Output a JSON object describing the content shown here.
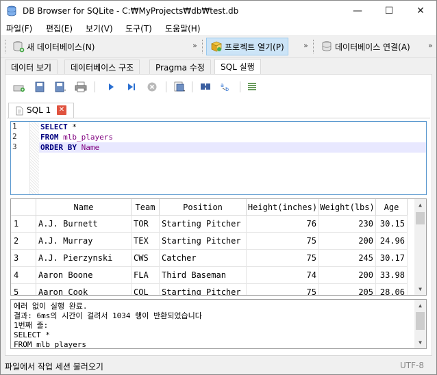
{
  "window": {
    "title": "DB Browser for SQLite - C:₩MyProjects₩db₩test.db",
    "controls": {
      "minimize": "—",
      "maximize": "☐",
      "close": "✕"
    }
  },
  "menu": [
    "파일(F)",
    "편집(E)",
    "보기(V)",
    "도구(T)",
    "도움말(H)"
  ],
  "main_toolbar": {
    "new_db": "새 데이터베이스(N)",
    "open_project": "프로젝트 열기(P)",
    "attach_db": "데이터베이스 연결(A)",
    "overflow": "»"
  },
  "tabs": [
    {
      "label": "데이터 보기",
      "active": false
    },
    {
      "label": "데이터베이스 구조",
      "active": false
    },
    {
      "label": "Pragma 수정",
      "active": false
    },
    {
      "label": "SQL 실행",
      "active": true
    }
  ],
  "sql_tab": {
    "label": "SQL 1",
    "close": "✕"
  },
  "editor": {
    "line_numbers": [
      "1",
      "2",
      "3"
    ],
    "lines": [
      [
        {
          "t": "SELECT ",
          "c": "kw"
        },
        {
          "t": "*",
          "c": ""
        }
      ],
      [
        {
          "t": "FROM ",
          "c": "kw"
        },
        {
          "t": "mlb_players",
          "c": "id"
        }
      ],
      [
        {
          "t": "ORDER BY ",
          "c": "kw"
        },
        {
          "t": "Name",
          "c": "id"
        }
      ]
    ],
    "current_line": 3
  },
  "results": {
    "columns": [
      "Name",
      "Team",
      "Position",
      "Height(inches)",
      "Weight(lbs)",
      "Age"
    ],
    "numeric_columns": [
      3,
      4,
      5
    ],
    "rows": [
      {
        "n": "1",
        "cells": [
          "A.J. Burnett",
          "TOR",
          "Starting Pitcher",
          "76",
          "230",
          "30.15"
        ]
      },
      {
        "n": "2",
        "cells": [
          "A.J. Murray",
          "TEX",
          "Starting Pitcher",
          "75",
          "200",
          "24.96"
        ]
      },
      {
        "n": "3",
        "cells": [
          "A.J. Pierzynski",
          "CWS",
          "Catcher",
          "75",
          "245",
          "30.17"
        ]
      },
      {
        "n": "4",
        "cells": [
          "Aaron Boone",
          "FLA",
          "Third Baseman",
          "74",
          "200",
          "33.98"
        ]
      },
      {
        "n": "5",
        "cells": [
          "Aaron Cook",
          "COL",
          "Starting Pitcher",
          "75",
          "205",
          "28.06"
        ]
      }
    ]
  },
  "messages": [
    "에러 없이 실행 완료.",
    "결과: 6ms의 시간이 걸려서 1034 행이 반환되었습니다",
    "1번째 줄:",
    "SELECT *",
    "FROM mlb_players"
  ],
  "status": {
    "text": "파일에서 작업 세션 불러오기",
    "encoding": "UTF-8"
  }
}
